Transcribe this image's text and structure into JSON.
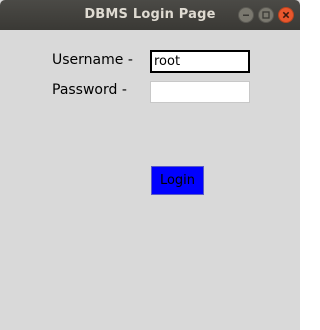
{
  "window": {
    "title": "DBMS Login Page",
    "controls": {
      "minimize": "minimize-icon",
      "maximize": "maximize-icon",
      "close": "close-icon"
    }
  },
  "form": {
    "username_label": "Username -",
    "username_value": "root",
    "password_label": "Password -",
    "password_value": "",
    "login_label": "Login"
  },
  "colors": {
    "background": "#d9d9d9",
    "titlebar": "#3c3b37",
    "login_button": "#0000ff",
    "close_button": "#e9572d"
  }
}
